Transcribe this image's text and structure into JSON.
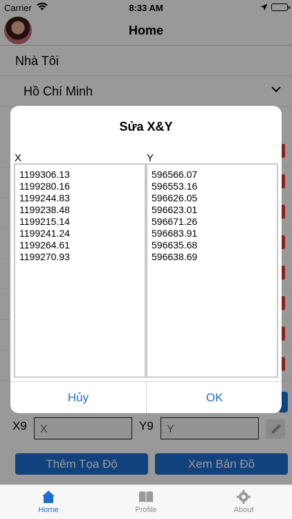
{
  "status": {
    "carrier": "Carrier",
    "time": "8:33 AM"
  },
  "nav": {
    "title": "Home"
  },
  "list": {
    "home_label": "Nhà Tôi",
    "city_value": "Hồ Chí Minh"
  },
  "coord_row": {
    "x_label": "X9",
    "x_placeholder": "X",
    "y_label": "Y9",
    "y_placeholder": "Y"
  },
  "actions": {
    "add_label": "Thêm Tọa Độ",
    "map_label": "Xem Bản Đồ"
  },
  "tabs": [
    {
      "label": "Home",
      "icon": "home-icon",
      "active": true
    },
    {
      "label": "Profile",
      "icon": "book-icon",
      "active": false
    },
    {
      "label": "About",
      "icon": "gear-icon",
      "active": false
    }
  ],
  "dialog": {
    "title": "Sửa X&Y",
    "x_header": "X",
    "y_header": "Y",
    "x_values": [
      "1199306.13",
      "1199280.16",
      "1199244.83",
      "1199238.48",
      "1199215.14",
      "1199241.24",
      "1199264.61",
      "1199270.93"
    ],
    "y_values": [
      "596566.07",
      "596553.16",
      "596626.05",
      "596623.01",
      "596671.26",
      "596683.91",
      "596635.68",
      "596638.69"
    ],
    "cancel_label": "Hủy",
    "ok_label": "OK"
  },
  "colors": {
    "accent": "#1f6fd0",
    "delete": "#e53935"
  }
}
